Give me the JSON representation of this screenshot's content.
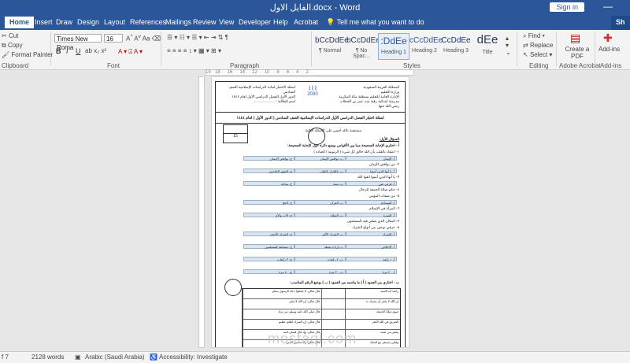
{
  "window": {
    "title": "الفايل الاول.docx - Word",
    "sign_in": "Sign in",
    "minimize": "—"
  },
  "tabs": [
    "Home",
    "Insert",
    "Draw",
    "Design",
    "Layout",
    "References",
    "Mailings",
    "Review",
    "View",
    "Developer",
    "Help",
    "Acrobat"
  ],
  "tell_me": "Tell me what you want to do",
  "share": "Sh",
  "ribbon": {
    "clipboard": {
      "label": "Clipboard",
      "cut": "Cut",
      "copy": "Copy",
      "format_painter": "Format Painter"
    },
    "font": {
      "label": "Font",
      "font_name": "Times New Roma",
      "font_size": "16",
      "bold": "B",
      "italic": "I",
      "underline": "U"
    },
    "paragraph": {
      "label": "Paragraph"
    },
    "styles": {
      "label": "Styles",
      "items": [
        {
          "sample": "bCcDdEe",
          "name": "¶ Normal"
        },
        {
          "sample": "bCcDdEe",
          "name": "¶ No Spac..."
        },
        {
          "sample": ":DdEe",
          "name": "Heading 1"
        },
        {
          "sample": "cCcDdEe",
          "name": "Heading 2"
        },
        {
          "sample": "CcDdEe",
          "name": "Heading 3"
        },
        {
          "sample": "dEe",
          "name": "Title"
        }
      ]
    },
    "editing": {
      "label": "Editing",
      "find": "Find",
      "replace": "Replace",
      "select": "Select"
    },
    "acrobat": {
      "label": "Adobe Acrobat",
      "create_pdf": "Create a PDF"
    },
    "addins": {
      "label": "Add-ins",
      "name": "Add-ins"
    }
  },
  "ruler": "19 · 18 · · 16 · · 14 · · 12 · · 10 · · 8 · · 6 · · 4 · · 2 · ·",
  "document": {
    "header_right": [
      "المملكة العربية السعودية",
      "وزارة التعليم",
      "الإدارة العامة للتعليم بمنطقة مكة المكرمة",
      "مدرسة ابتدائية رقية بنت عمر بن الخطاب رضي الله عنها"
    ],
    "header_left": [
      "اسئلة الاختبار لمادة الدراسات الإسلامية الصف السادس",
      "الدور الأول الفصل الدراسي الأول لعام ١٤٤٤",
      "اسم الطالبة : ......................"
    ],
    "logo": "2030",
    "title": "اسئلة اختبار الفصل الدراسي الأول للدراسات الإسلامية الصف السادس ( الدور الأول ) لعام ١٤٤٤",
    "instruction": "مستعينة بالله أجيبي على الأسئلة التالية:",
    "grade": "15",
    "q1": "السؤال الأول:",
    "q1a": "أ - اختاري الإجابة الصحيحة مما بين الأقواس بوضع دائرة حول الإجابة الصحيحة:",
    "lines": [
      "١- اعتقاد بالقلب بأن الله خالق كل شيء ( الربوبية / العبادة )",
      "٢- من نواقض الإيمان",
      "٣- يا أيها الذين آمنوا اتقوا الله",
      "٤- حكم صلاة الجمعة للرجال",
      "٥- من صفات المؤمن",
      "٦- المرأة في الإسلام",
      "٧- المكان الذي يصلي فيه المسلمون",
      "٨- عرفي نوعين من أنواع الشرك"
    ],
    "options": [
      [
        "أ- الإيمان",
        "ب- نواقض الإيمان",
        "ج- نواقض الإيمان"
      ],
      [
        "أ- يا أيها الذين آمنوا",
        "ب- بالإقرار بالقلب",
        "ج- الشهر الخامس"
      ],
      [
        "أ- فرض عين",
        "ب- سنة",
        "ج- مباحة"
      ],
      [
        "أ- المساجد",
        "ب- القرآن",
        "ج- الحج"
      ],
      [
        "أ- العمرة",
        "ب- الصلاة",
        "ج- الأب والأم"
      ],
      [
        "أ- الشرك",
        "ب- الشرك الأكبر",
        "ج- الشرك الأصغر"
      ],
      [
        "أ- الإخلاص",
        "ب- إرادة بعمله",
        "ج- مسابقة للمسلمين"
      ],
      [
        "أ- ١ ركعة",
        "ب- ٢ ركعات",
        "ج- ٣ ركعات"
      ],
      [
        "أ- ٢٠ مرة",
        "ب- ٣٠ مرة",
        "ج- ٤٠ مرة"
      ]
    ],
    "q1b": "ب - اختاري من العمود ( أ ) ما يناسبه من العمود ( ب ) بوضع الرقم المناسب:",
    "table": [
      [
        "رابعة أنه الحمد",
        "قال تعالى: لا تجعلوا دعاء الرسول بينكم"
      ],
      [
        "إن الله لا يغفر أن يشرك به",
        "قال تعالى: إن الله لا يغفر"
      ],
      [
        "صوم صلاة الجمعة",
        "قال صلى الله عليه وسلم: من ترك"
      ],
      [
        "التفريق في الله الكفر",
        "قال تعالى: إن الشرك لظلم عظيم"
      ],
      [
        "يبغض من نعمه",
        "قال تعالى: وإذ قال لقمان لابنه"
      ],
      [
        "وقلبي مستقر مع الحياة",
        "قال تعالى: ولا تحسبن الذين"
      ]
    ]
  },
  "status": {
    "page": "f 7",
    "words": "2128 words",
    "language": "Arabic (Saudi Arabia)",
    "accessibility": "Accessibility: Investigate"
  },
  "watermark": "mostaql.com"
}
